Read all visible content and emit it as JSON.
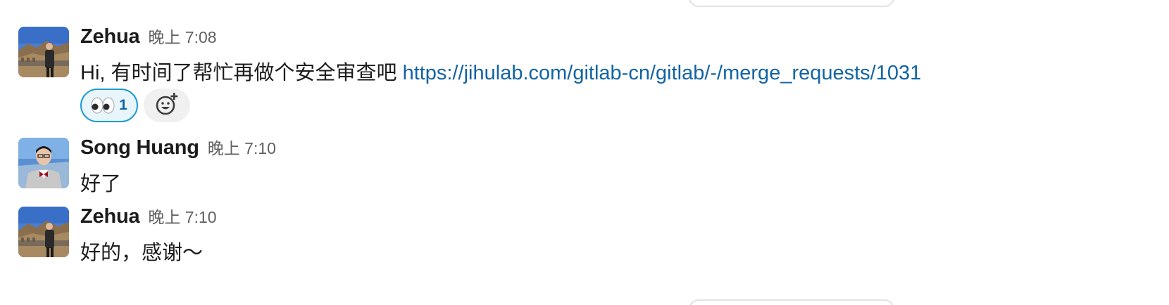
{
  "messages": [
    {
      "author": "Zehua",
      "time": "晚上 7:08",
      "text_prefix": "Hi, 有时间了帮忙再做个安全审查吧 ",
      "link": "https://jihulab.com/gitlab-cn/gitlab/-/merge_requests/1031",
      "avatar_icon": "great-wall-photo",
      "reactions": [
        {
          "emoji": "eyes-icon",
          "count": "1"
        }
      ]
    },
    {
      "author": "Song Huang",
      "time": "晚上 7:10",
      "text": "好了",
      "avatar_icon": "portrait-photo"
    },
    {
      "author": "Zehua",
      "time": "晚上 7:10",
      "text": "好的，感谢～",
      "avatar_icon": "great-wall-photo"
    }
  ],
  "colors": {
    "link": "#1264a3",
    "reaction_border": "#1d9bd1",
    "reaction_bg": "#e8f5fa",
    "timestamp": "#616061"
  }
}
